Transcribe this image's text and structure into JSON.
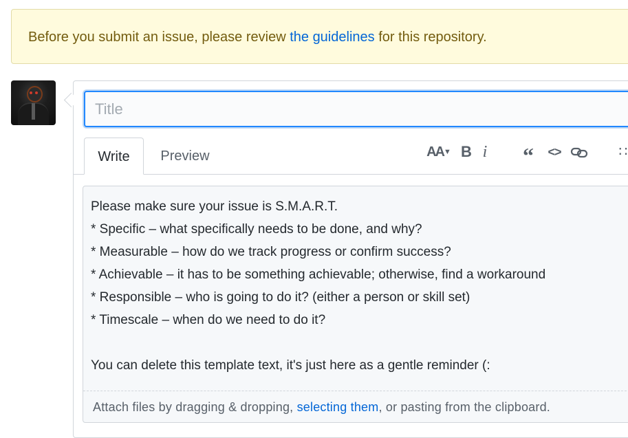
{
  "flash": {
    "before": "Before you submit an issue, please review ",
    "link": "the guidelines",
    "after": " for this repository."
  },
  "title_input": {
    "placeholder": "Title",
    "value": ""
  },
  "tabs": {
    "write": "Write",
    "preview": "Preview"
  },
  "toolbar": {
    "heading_icon": "text-size-icon",
    "heading_glyph": "AA",
    "bold_icon": "bold-icon",
    "bold_glyph": "B",
    "italic_icon": "italic-icon",
    "italic_glyph": "i",
    "quote_icon": "quote-icon",
    "quote_glyph": "“",
    "code_icon": "code-icon",
    "code_glyph": "<>",
    "link_icon": "link-icon",
    "list_icon": "list-unordered-icon",
    "list_glyph": "∷"
  },
  "editor": {
    "lines": [
      "Please make sure your issue is S.M.A.R.T.",
      "* Specific – what specifically needs to be done, and why?",
      "* Measurable – how do we track progress or confirm success?",
      "* Achievable – it has to be something achievable; otherwise, find a workaround",
      "* Responsible – who is going to do it? (either a person or skill set)",
      "* Timescale – when do we need to do it?",
      "",
      "You can delete this template text, it's just here as a gentle reminder (:"
    ]
  },
  "attach": {
    "before": "Attach files by dragging & dropping, ",
    "link": "selecting them",
    "after": ", or pasting from the clipboard."
  },
  "colors": {
    "flash_bg": "#fffbdd",
    "flash_text": "#735c0f",
    "link": "#0366d6",
    "focus_border": "#2188ff"
  }
}
